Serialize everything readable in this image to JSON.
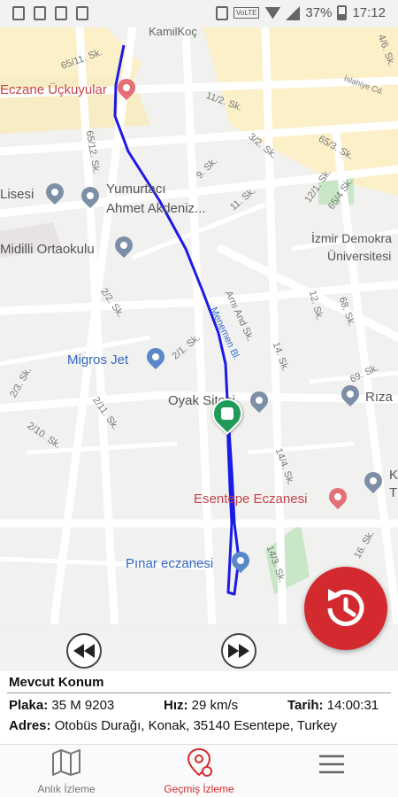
{
  "status_bar": {
    "battery": "37%",
    "time": "17:12",
    "network": "VoLTE"
  },
  "map": {
    "streets": [
      "KamilKoç",
      "65/11. Sk.",
      "4/6. Sk.",
      "11/2. Sk.",
      "İslahiye Cd.",
      "65/12. Sk.",
      "3/2. Sk.",
      "65/3. Sk.",
      "9. Sk.",
      "12/1. Sk.",
      "65/4 Sk.",
      "11. Sk.",
      "2/2. Sk.",
      "Arnı And Sk.",
      "Menemen Bl.",
      "12. Sk.",
      "68. Sk.",
      "2/1. Sk.",
      "14. Sk.",
      "69. Sk.",
      "2/3. Sk.",
      "2/11. Sk.",
      "2/10. Sk.",
      "14/4. Sk.",
      "14/3. Sk.",
      "16. Sk."
    ],
    "pois": {
      "eczane_uckuyular": "Eczane Üçkuyular",
      "lisesi": "Lisesi",
      "yumurtaci": "Yumurtacı",
      "ahmet_akdeniz": "Ahmet Akdeniz...",
      "midilli": "Midilli Ortaokulu",
      "izmir_demo_1": "İzmir Demokra",
      "izmir_demo_2": "Üniversitesi",
      "migros": "Migros Jet",
      "oyak": "Oyak Sitesi",
      "riza": "Rıza",
      "k_letter": "K",
      "t_letter": "T",
      "esentepe": "Esentepe Eczanesi",
      "pinar": "Pınar eczanesi"
    },
    "route_color": "#1b1be6"
  },
  "info": {
    "title": "Mevcut Konum",
    "plate_label": "Plaka:",
    "plate_value": "35 M 9203",
    "speed_label": "Hız:",
    "speed_value": "29 km/s",
    "date_label": "Tarih:",
    "date_value": "14:00:31",
    "address_label": "Adres:",
    "address_value": "Otobüs Durağı, Konak, 35140 Esentepe, Turkey"
  },
  "nav": [
    {
      "label": "Anlık İzleme",
      "icon": "map-icon"
    },
    {
      "label": "Geçmiş İzleme",
      "icon": "location-history-icon"
    },
    {
      "label": "",
      "icon": "menu-icon"
    }
  ],
  "colors": {
    "accent": "#d32a2f",
    "bus": "#1f9a59"
  }
}
